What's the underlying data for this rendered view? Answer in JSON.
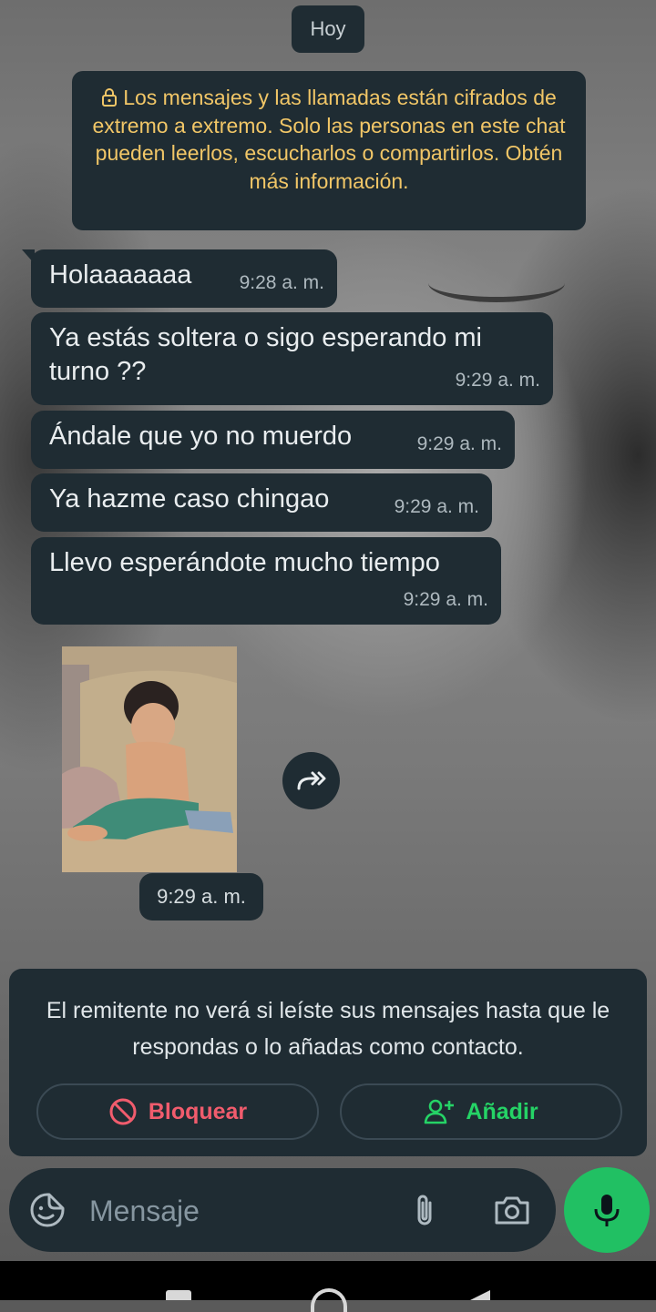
{
  "date_chip": "Hoy",
  "encryption_notice": "Los mensajes y las llamadas están cifrados de extremo a extremo. Solo las personas en este chat pueden leerlos, escucharlos o compartirlos. Obtén más información.",
  "messages": [
    {
      "text": "Holaaaaaaa",
      "time": "9:28 a. m."
    },
    {
      "text": "Ya estás soltera o sigo esperando mi turno ??",
      "time": "9:29 a. m."
    },
    {
      "text": "Ándale que yo no muerdo",
      "time": "9:29 a. m."
    },
    {
      "text": "Ya hazme caso chingao",
      "time": "9:29 a. m."
    },
    {
      "text": "Llevo esperándote mucho tiempo",
      "time": "9:29 a. m."
    }
  ],
  "image_message": {
    "time": "9:29 a. m."
  },
  "unknown_sender": {
    "notice": "El remitente no verá si leíste sus mensajes hasta que le respondas o lo añadas como contacto.",
    "block_label": "Bloquear",
    "add_label": "Añadir"
  },
  "composer": {
    "placeholder": "Mensaje"
  },
  "colors": {
    "bubble": "#1f2c33",
    "notice_text": "#f1c667",
    "block": "#f15c6d",
    "add": "#25d366",
    "mic": "#21c063"
  }
}
